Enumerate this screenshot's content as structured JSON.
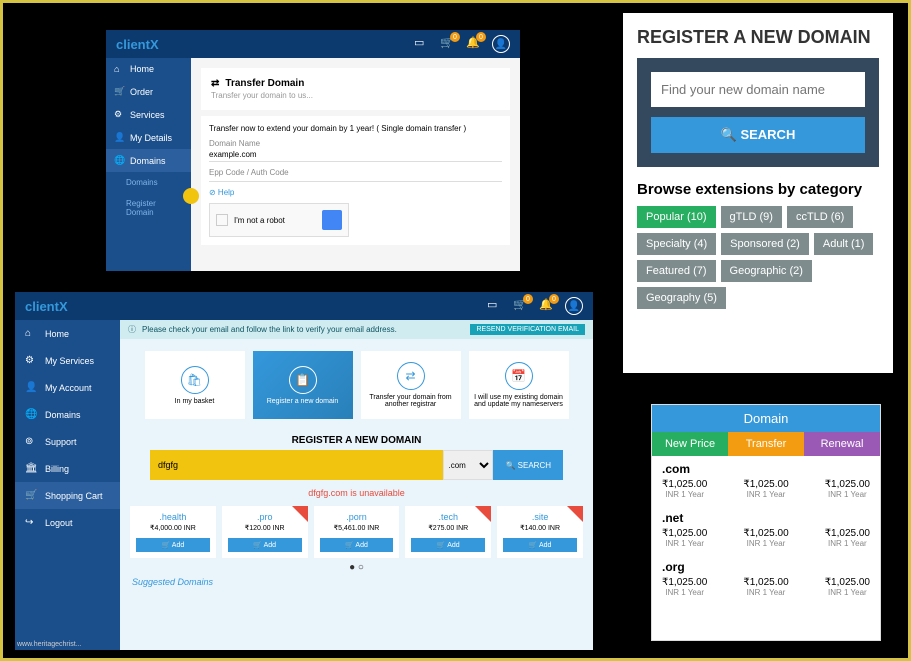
{
  "p1": {
    "logo": "client",
    "logoX": "X",
    "nav": [
      {
        "icon": "⌂",
        "label": "Home"
      },
      {
        "icon": "🛒",
        "label": "Order"
      },
      {
        "icon": "⚙",
        "label": "Services"
      },
      {
        "icon": "👤",
        "label": "My Details"
      },
      {
        "icon": "🌐",
        "label": "Domains"
      }
    ],
    "sub": [
      {
        "label": "Domains"
      },
      {
        "label": "Register Domain"
      }
    ],
    "card": {
      "title": "Transfer Domain",
      "sub": "Transfer your domain to us..."
    },
    "transfer": {
      "notice": "Transfer now to extend your domain by 1 year!   ( Single domain transfer )",
      "domainLabel": "Domain Name",
      "domainVal": "example.com",
      "eppLabel": "Epp Code / Auth Code",
      "help": "⊘ Help",
      "captcha": "I'm not a robot"
    }
  },
  "p2": {
    "logo": "client",
    "logoX": "X",
    "nav": [
      {
        "icon": "⌂",
        "label": "Home"
      },
      {
        "icon": "⚙",
        "label": "My Services"
      },
      {
        "icon": "👤",
        "label": "My Account"
      },
      {
        "icon": "🌐",
        "label": "Domains"
      },
      {
        "icon": "⊚",
        "label": "Support"
      },
      {
        "icon": "🏛",
        "label": "Billing"
      },
      {
        "icon": "🛒",
        "label": "Shopping Cart"
      },
      {
        "icon": "↪",
        "label": "Logout"
      }
    ],
    "alert": {
      "text": "Please check your email and follow the link to verify your email address.",
      "btn": "RESEND VERIFICATION EMAIL"
    },
    "tiles": [
      {
        "icon": "🛍",
        "label": "In my basket"
      },
      {
        "icon": "📋",
        "label": "Register a new domain"
      },
      {
        "icon": "⇄",
        "label": "Transfer your domain from another registrar"
      },
      {
        "icon": "📅",
        "label": "I will use my existing domain and update my nameservers"
      }
    ],
    "regtitle": "REGISTER A NEW DOMAIN",
    "search": {
      "value": "dfgfg",
      "ext": ".com",
      "btn": "🔍 SEARCH"
    },
    "unavail": "dfgfg.com is unavailable",
    "cards": [
      {
        "name": ".health",
        "price": "₹4,000.00 INR",
        "hot": false
      },
      {
        "name": ".pro",
        "price": "₹120.00 INR",
        "hot": true
      },
      {
        "name": ".porn",
        "price": "₹5,461.00 INR",
        "hot": false
      },
      {
        "name": ".tech",
        "price": "₹275.00 INR",
        "hot": true
      },
      {
        "name": ".site",
        "price": "₹140.00 INR",
        "hot": true
      }
    ],
    "addBtn": "🛒 Add",
    "suggest": "Suggested Domains"
  },
  "p3": {
    "title": "REGISTER A NEW DOMAIN",
    "placeholder": "Find your new domain name",
    "searchBtn": "🔍  SEARCH",
    "browse": "Browse extensions by category",
    "tags": [
      {
        "label": "Popular (10)",
        "green": true
      },
      {
        "label": "gTLD (9)"
      },
      {
        "label": "ccTLD (6)"
      },
      {
        "label": "Specialty (4)"
      },
      {
        "label": "Sponsored (2)"
      },
      {
        "label": "Adult (1)"
      },
      {
        "label": "Featured (7)"
      },
      {
        "label": "Geographic (2)"
      },
      {
        "label": "Geography (5)"
      }
    ]
  },
  "p4": {
    "head": "Domain",
    "tabs": [
      "New Price",
      "Transfer",
      "Renewal"
    ],
    "rows": [
      {
        "ext": ".com",
        "prices": [
          "₹1,025.00",
          "₹1,025.00",
          "₹1,025.00"
        ],
        "sub": "INR 1 Year"
      },
      {
        "ext": ".net",
        "prices": [
          "₹1,025.00",
          "₹1,025.00",
          "₹1,025.00"
        ],
        "sub": "INR 1 Year"
      },
      {
        "ext": ".org",
        "prices": [
          "₹1,025.00",
          "₹1,025.00",
          "₹1,025.00"
        ],
        "sub": "INR 1 Year"
      }
    ]
  },
  "watermark": "www.heritagechrist..."
}
